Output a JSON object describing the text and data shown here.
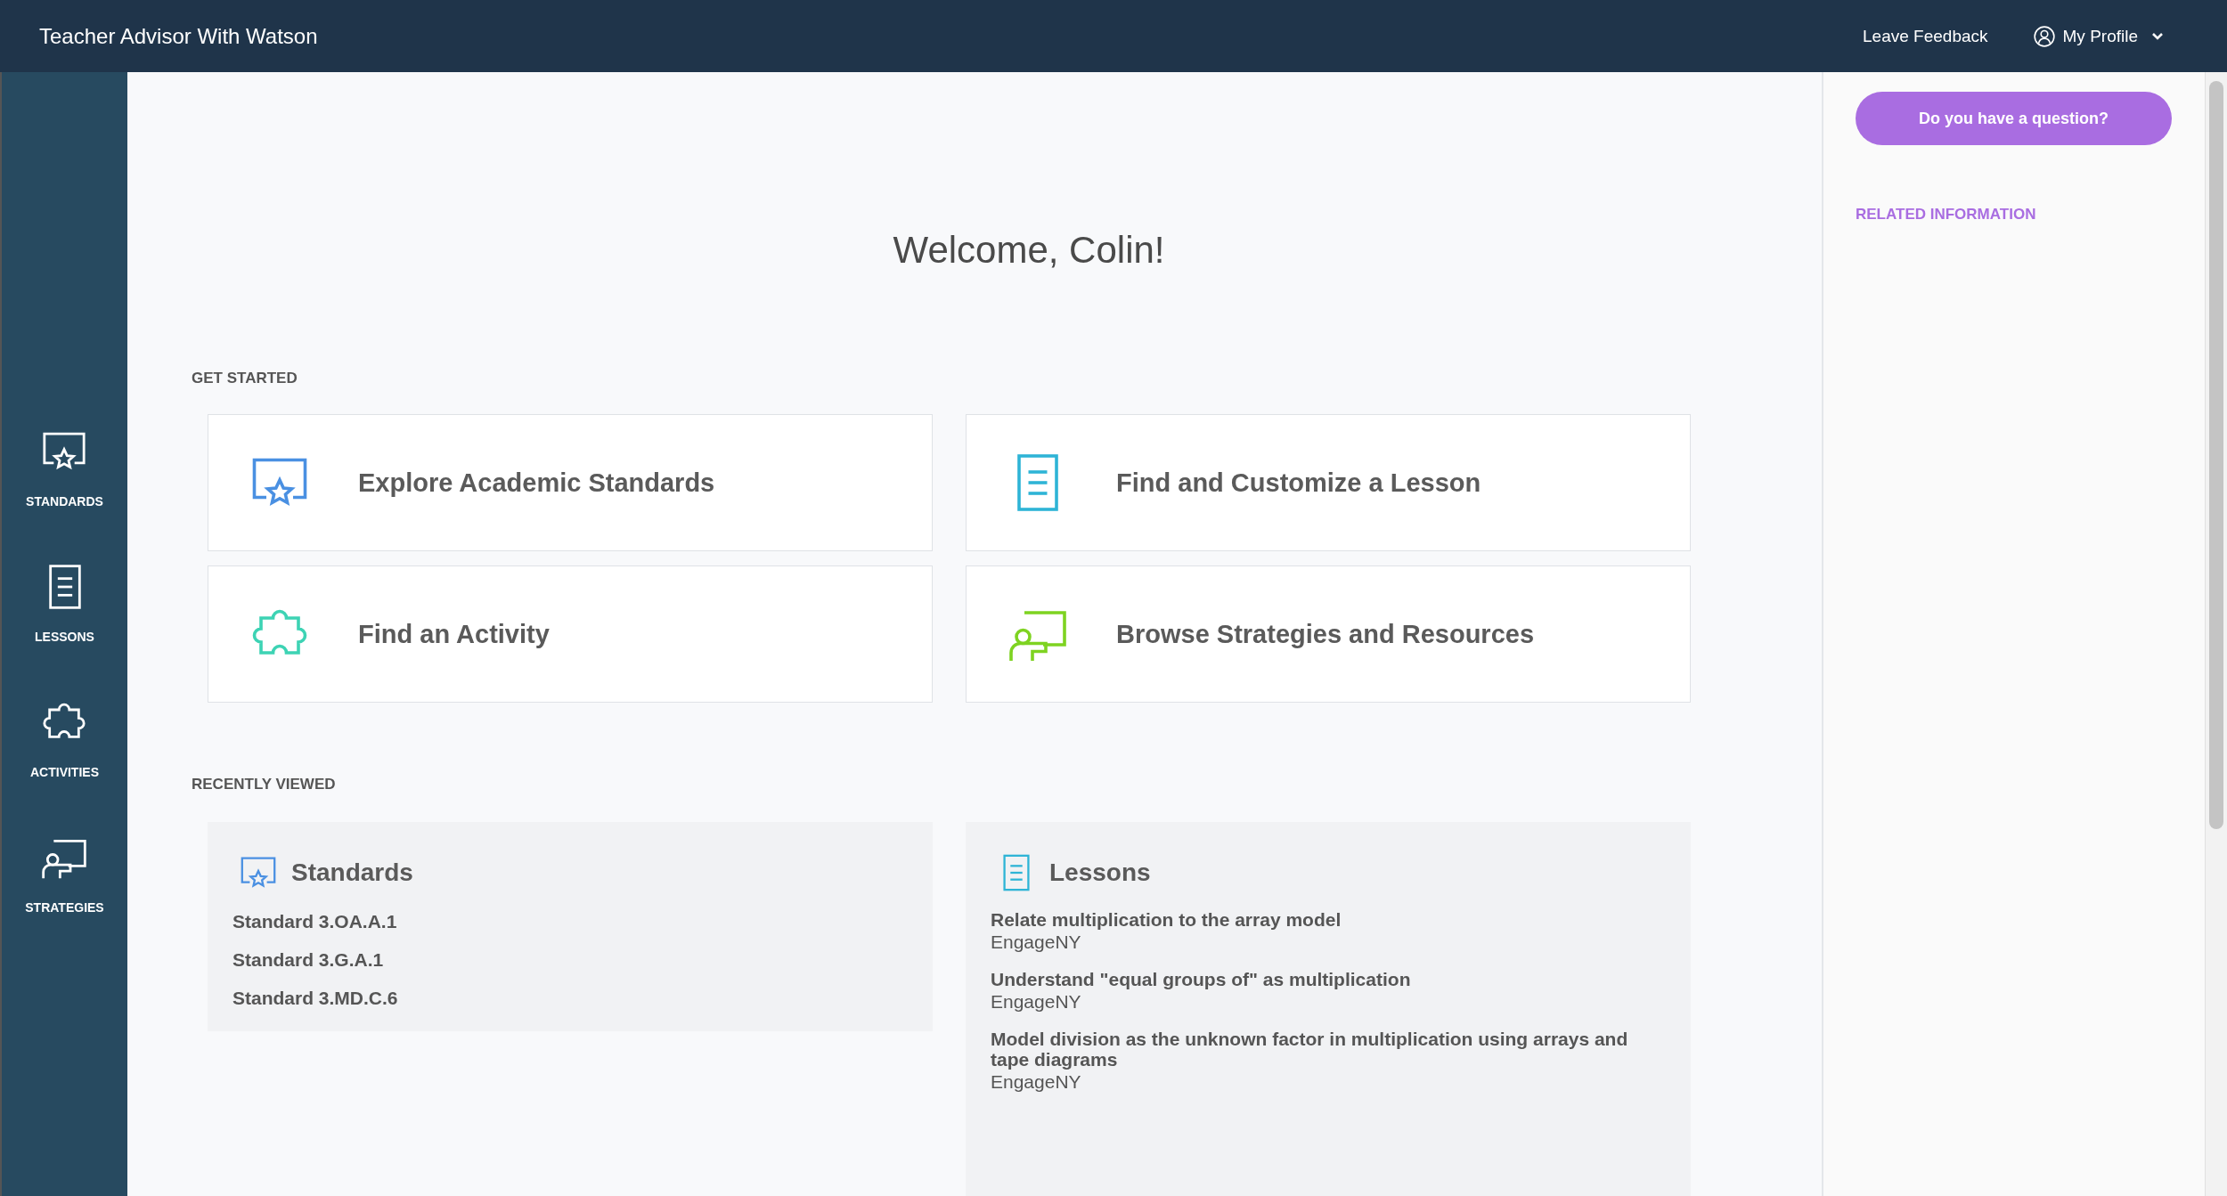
{
  "header": {
    "title": "Teacher Advisor With Watson",
    "links": [
      {
        "label": "Leave Feedback",
        "kind": "link"
      },
      {
        "label": "My Profile",
        "kind": "profile"
      }
    ]
  },
  "sidebar": {
    "items": [
      {
        "label": "STANDARDS",
        "kind": "standards"
      },
      {
        "label": "LESSONS",
        "kind": "lessons"
      },
      {
        "label": "ACTIVITIES",
        "kind": "activities"
      },
      {
        "label": "STRATEGIES",
        "kind": "strategies"
      }
    ]
  },
  "welcome": "Welcome, Colin!",
  "get_started": {
    "heading": "GET STARTED",
    "cards": [
      {
        "label": "Explore Academic Standards",
        "kind": "standards",
        "color": "#4a90e2"
      },
      {
        "label": "Find and Customize a Lesson",
        "kind": "lessons",
        "color": "#2eb4d6"
      },
      {
        "label": "Find an Activity",
        "kind": "activities",
        "color": "#3dd3b4"
      },
      {
        "label": "Browse Strategies and Resources",
        "kind": "strategies",
        "color": "#7ed321"
      }
    ]
  },
  "recently_viewed": {
    "heading": "RECENTLY VIEWED",
    "panels": [
      {
        "title": "Standards",
        "kind": "standards",
        "color": "#4a90e2",
        "items": [
          {
            "title": "Standard 3.OA.A.1"
          },
          {
            "title": "Standard 3.G.A.1"
          },
          {
            "title": "Standard 3.MD.C.6"
          }
        ]
      },
      {
        "title": "Lessons",
        "kind": "lessons",
        "color": "#2eb4d6",
        "items": [
          {
            "title": "Relate multiplication to the array model",
            "source": "EngageNY"
          },
          {
            "title": "Understand \"equal groups of\" as multiplication",
            "source": "EngageNY"
          },
          {
            "title": "Model division as the unknown factor in multiplication using arrays and tape diagrams",
            "source": "EngageNY"
          }
        ]
      }
    ]
  },
  "right_panel": {
    "button": "Do you have a question?",
    "heading": "RELATED INFORMATION"
  }
}
